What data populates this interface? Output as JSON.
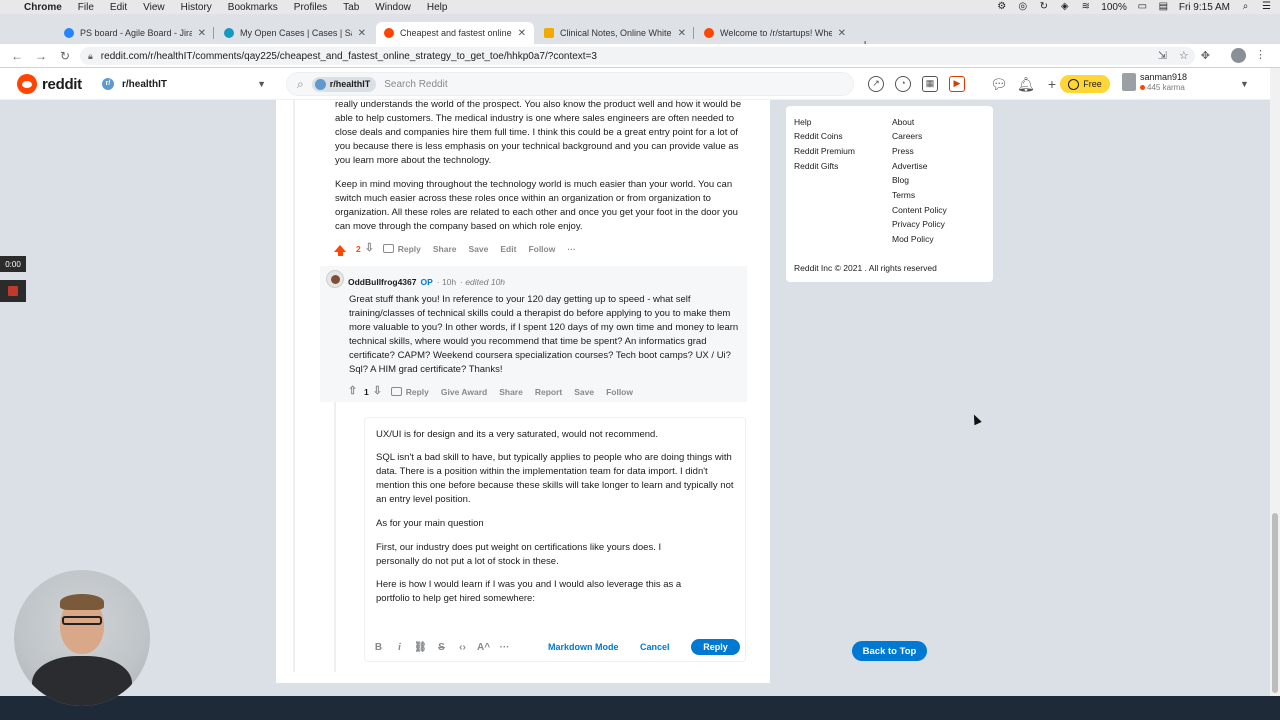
{
  "menubar": {
    "app": "Chrome",
    "items": [
      "File",
      "Edit",
      "View",
      "History",
      "Bookmarks",
      "Profiles",
      "Tab",
      "Window",
      "Help"
    ],
    "battery": "100%",
    "clock": "Fri 9:15 AM"
  },
  "tabs": [
    {
      "title": "PS board - Agile Board - Jira",
      "color": "#2684ff"
    },
    {
      "title": "My Open Cases | Cases | Sale",
      "color": "#1798c1"
    },
    {
      "title": "Cheapest and fastest online st",
      "color": "#ff4500"
    },
    {
      "title": "Clinical Notes, Online Whitebo",
      "color": "#f2a900"
    },
    {
      "title": "Welcome to /r/startups! Where",
      "color": "#ff4500"
    }
  ],
  "address": {
    "url": "reddit.com/r/healthIT/comments/qay225/cheapest_and_fastest_online_strategy_to_get_toe/hhkp0a7/?context=3"
  },
  "reddit": {
    "logo": "reddit",
    "community": "r/healthIT",
    "search_chip": "r/healthIT",
    "search_placeholder": "Search Reddit",
    "free_label": "Free",
    "username": "sanman918",
    "karma": "445 karma"
  },
  "parent_comment": {
    "para1": "really understands the world of the prospect. You also know the product well and how it would be able to help customers. The medical industry is one where sales engineers are often needed to close deals and companies hire them full time. I think this could be a great entry point for a lot of you because there is less emphasis on your technical background and you can provide value as you learn more about the technology.",
    "para2": "Keep in mind moving throughout the technology world is much easier than your world. You can switch much easier across these roles once within an organization or from organization to organization. All these roles are related to each other and once you get your foot in the door you can move through the company based on which role enjoy.",
    "score": "2",
    "actions": [
      "Reply",
      "Share",
      "Save",
      "Edit",
      "Follow"
    ],
    "more": "···"
  },
  "reply_comment": {
    "username": "OddBullfrog4367",
    "op": "OP",
    "time": "· 10h",
    "edited": "· edited 10h",
    "body": "Great stuff thank you! In reference to your 120 day getting up to speed - what self training/classes of technical skills could a therapist do before applying to you to make them more valuable to you? In other words, if I spent 120 days of my own time and money to learn technical skills, where would you recommend that time be spent? An informatics grad certificate? CAPM? Weekend coursera specialization courses? Tech boot camps? UX / Ui? Sql? A HIM grad certificate? Thanks!",
    "score": "1",
    "actions": [
      "Reply",
      "Give Award",
      "Share",
      "Report",
      "Save",
      "Follow"
    ]
  },
  "draft": {
    "p1": "UX/UI is for design and its a very saturated, would not recommend.",
    "p2": "SQL isn't a bad skill to have, but typically applies to people who are doing things with data.  There is a position within the implementation team for data import.  I didn't mention this one before because these skills will take longer to learn and typically not an entry level position.",
    "p3": "As for your main question",
    "p4": "First, our industry does put weight on certifications like yours does.  I personally do not put a lot of stock in these.",
    "p5": "Here is how I would learn if I was you and I would also leverage this as a portfolio to help get hired somewhere:",
    "markdown_mode": "Markdown Mode",
    "cancel": "Cancel",
    "reply": "Reply"
  },
  "sidebar": {
    "col1": [
      "Help",
      "Reddit Coins",
      "Reddit Premium",
      "Reddit Gifts"
    ],
    "col2": [
      "About",
      "Careers",
      "Press",
      "Advertise",
      "Blog",
      "Terms",
      "Content Policy",
      "Privacy Policy",
      "Mod Policy"
    ],
    "copyright": "Reddit Inc © 2021 . All rights reserved",
    "back_to_top": "Back to Top"
  },
  "recorder": {
    "timer": "0:00"
  }
}
